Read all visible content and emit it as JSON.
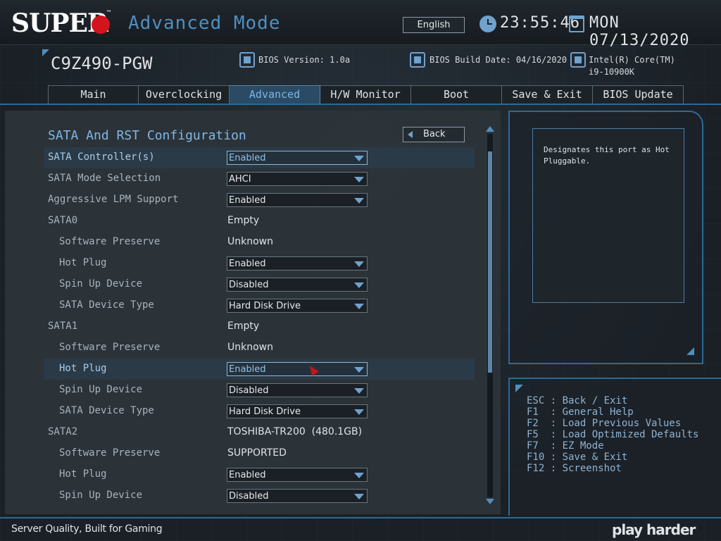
{
  "header": {
    "logo": "SUPER",
    "logo_tm": "™",
    "mode_title": "Advanced Mode",
    "language": "English",
    "time": "23:55:46",
    "date": "MON 07/13/2020"
  },
  "info": {
    "board_name": "C9Z490-PGW",
    "bios_version": "BIOS Version: 1.0a",
    "bios_build_date": "BIOS Build Date: 04/16/2020",
    "cpu_line1": "Intel(R) Core(TM)",
    "cpu_line2": "i9-10900K"
  },
  "tabs": [
    {
      "label": "Main"
    },
    {
      "label": "Overclocking"
    },
    {
      "label": "Advanced",
      "active": true
    },
    {
      "label": "H/W Monitor"
    },
    {
      "label": "Boot"
    },
    {
      "label": "Save & Exit"
    },
    {
      "label": "BIOS Update"
    }
  ],
  "section": {
    "title": "SATA And RST Configuration",
    "back_label": "Back"
  },
  "rows": [
    {
      "label": "SATA Controller(s)",
      "level": 0,
      "type": "dropdown",
      "value": "Enabled",
      "selected": true
    },
    {
      "label": "SATA Mode Selection",
      "level": 0,
      "type": "dropdown",
      "value": "AHCI"
    },
    {
      "label": "Aggressive LPM Support",
      "level": 0,
      "type": "dropdown",
      "value": "Enabled"
    },
    {
      "label": "SATA0",
      "level": 0,
      "type": "text",
      "value": "Empty"
    },
    {
      "label": "Software Preserve",
      "level": 1,
      "type": "text",
      "value": "Unknown"
    },
    {
      "label": "Hot Plug",
      "level": 1,
      "type": "dropdown",
      "value": "Enabled"
    },
    {
      "label": "Spin Up Device",
      "level": 1,
      "type": "dropdown",
      "value": "Disabled"
    },
    {
      "label": "SATA Device Type",
      "level": 1,
      "type": "dropdown",
      "value": "Hard Disk Drive"
    },
    {
      "label": "SATA1",
      "level": 0,
      "type": "text",
      "value": "Empty"
    },
    {
      "label": "Software Preserve",
      "level": 1,
      "type": "text",
      "value": "Unknown"
    },
    {
      "label": "Hot Plug",
      "level": 1,
      "type": "dropdown",
      "value": "Enabled",
      "selected": true
    },
    {
      "label": "Spin Up Device",
      "level": 1,
      "type": "dropdown",
      "value": "Disabled"
    },
    {
      "label": "SATA Device Type",
      "level": 1,
      "type": "dropdown",
      "value": "Hard Disk Drive"
    },
    {
      "label": "SATA2",
      "level": 0,
      "type": "text",
      "value": "TOSHIBA-TR200  (480.1GB)"
    },
    {
      "label": "Software Preserve",
      "level": 1,
      "type": "text",
      "value": "SUPPORTED"
    },
    {
      "label": "Hot Plug",
      "level": 1,
      "type": "dropdown",
      "value": "Enabled"
    },
    {
      "label": "Spin Up Device",
      "level": 1,
      "type": "dropdown",
      "value": "Disabled"
    }
  ],
  "help": {
    "text": "Designates this port as Hot Pluggable."
  },
  "keys": [
    "ESC : Back / Exit",
    "F1  : General Help",
    "F2  : Load Previous Values",
    "F5  : Load Optimized Defaults",
    "F7  : EZ Mode",
    "F10 : Save & Exit",
    "F12 : Screenshot"
  ],
  "footer": {
    "left": "Server Quality, Built for Gaming",
    "right": "play harder"
  },
  "colors": {
    "accent": "#4f8fbf",
    "brand_red": "#d3141c",
    "active_tab": "#2a4a66"
  },
  "icons": {
    "clock": "clock-icon",
    "calendar": "calendar-icon",
    "bios_chip": "chip-icon",
    "build_date": "build-icon",
    "cpu": "cpu-icon"
  }
}
